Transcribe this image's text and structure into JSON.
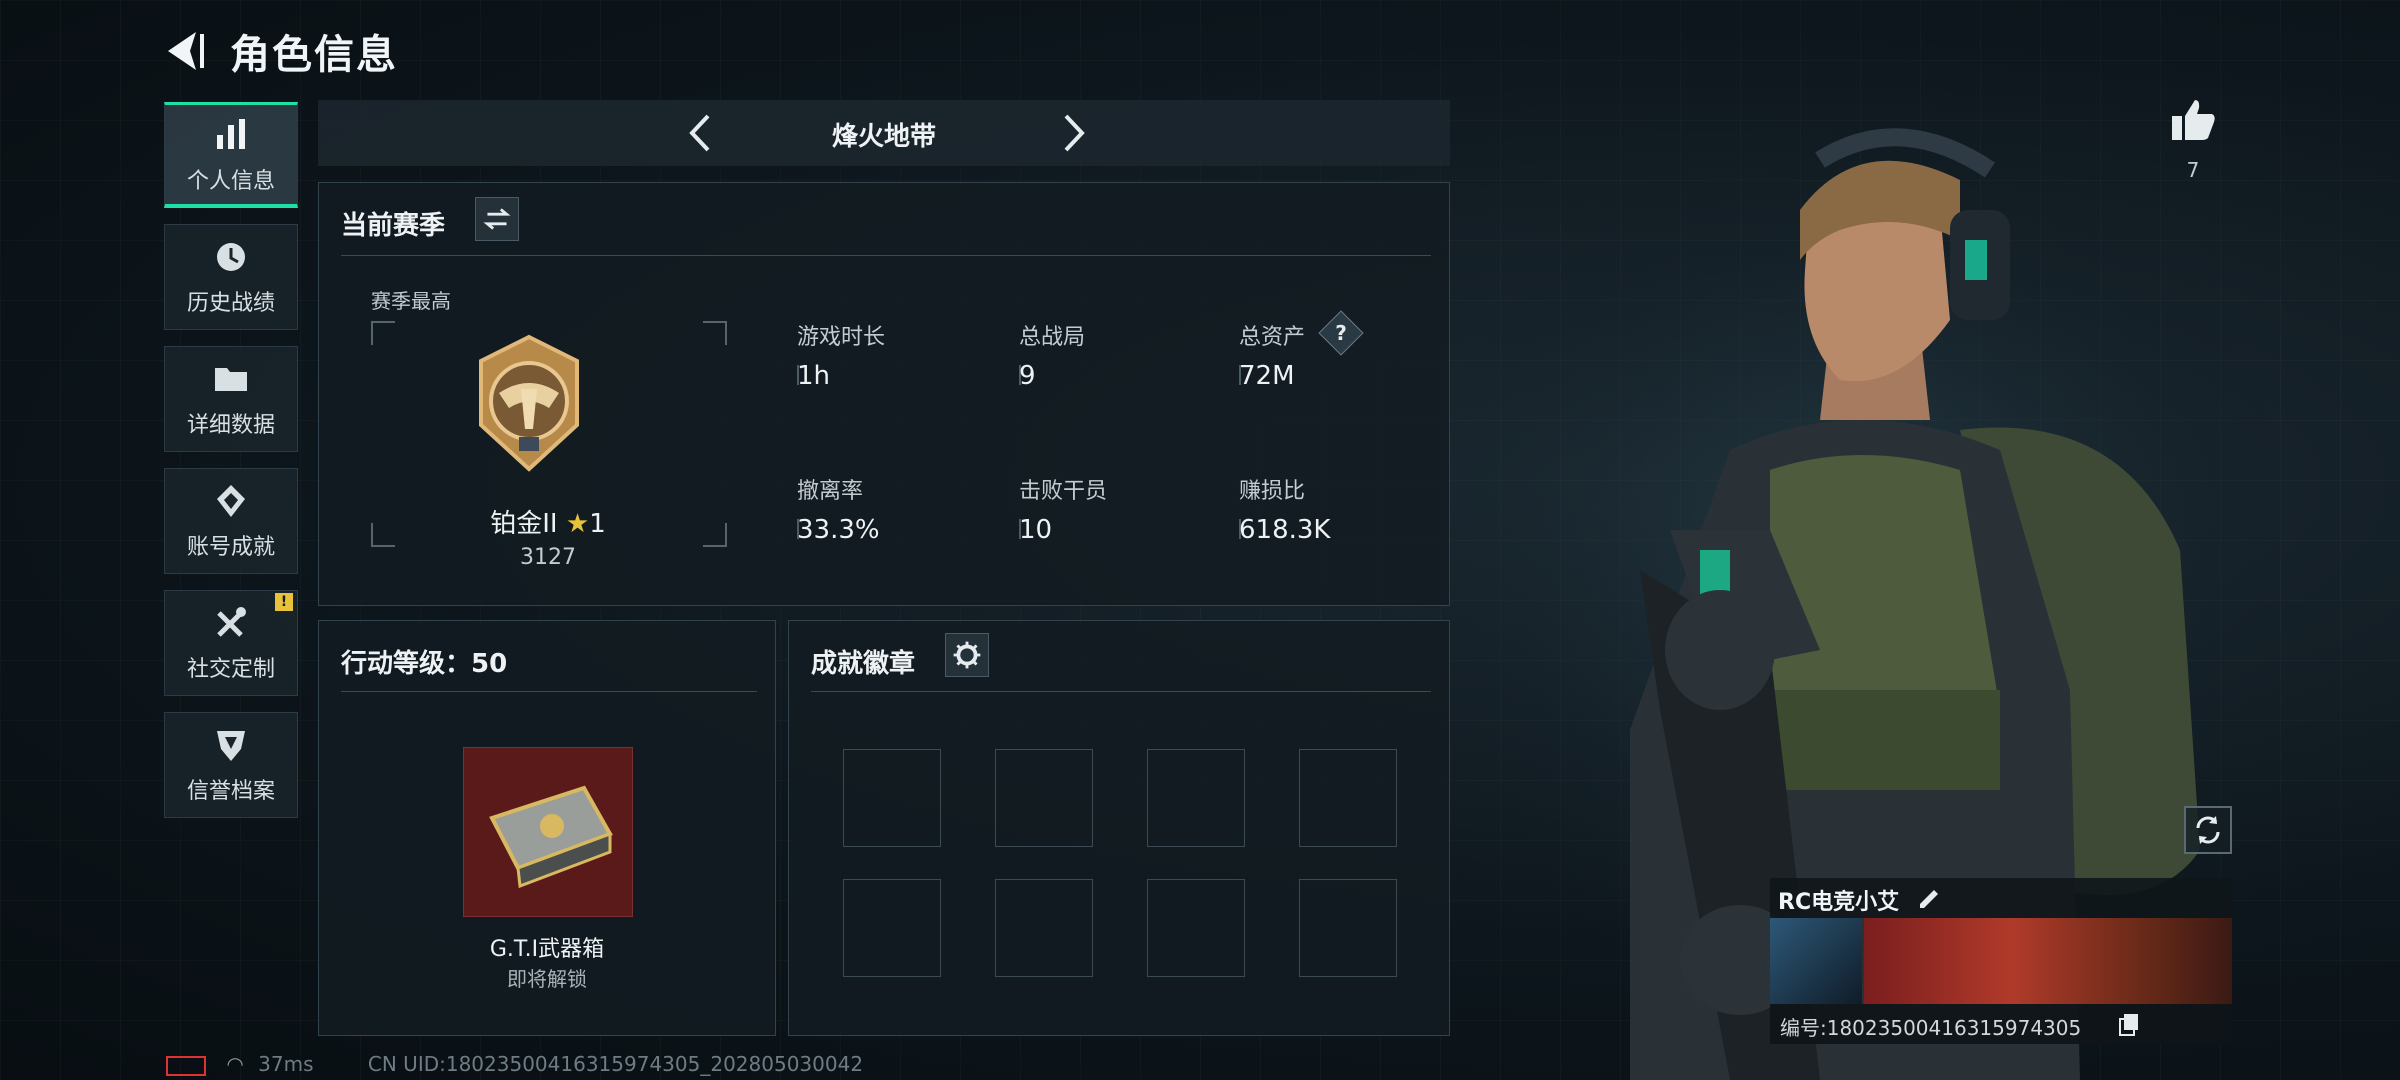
{
  "header": {
    "title": "角色信息",
    "back_icon": "back-arrow-icon"
  },
  "sidebar": {
    "items": [
      {
        "label": "个人信息",
        "icon": "bar-chart-icon",
        "active": true
      },
      {
        "label": "历史战绩",
        "icon": "clock-icon"
      },
      {
        "label": "详细数据",
        "icon": "folder-icon"
      },
      {
        "label": "账号成就",
        "icon": "achievement-icon"
      },
      {
        "label": "社交定制",
        "icon": "tools-icon",
        "badge": "!"
      },
      {
        "label": "信誉档案",
        "icon": "shield-icon"
      }
    ]
  },
  "mode": {
    "label": "烽火地带"
  },
  "season": {
    "title": "当前赛季",
    "best_label": "赛季最高",
    "rank_name": "铂金II",
    "rank_stars": "1",
    "rank_points": "3127",
    "stats": [
      {
        "label": "游戏时长",
        "value": "1h"
      },
      {
        "label": "总战局",
        "value": "9"
      },
      {
        "label": "总资产",
        "value": "72M",
        "help": "?"
      },
      {
        "label": "撤离率",
        "value": "33.3%"
      },
      {
        "label": "击败干员",
        "value": "10"
      },
      {
        "label": "赚损比",
        "value": "618.3K"
      }
    ]
  },
  "level": {
    "title": "行动等级：50",
    "reward_name": "G.T.I武器箱",
    "reward_status": "即将解锁"
  },
  "achievements": {
    "title": "成就徽章"
  },
  "likes": {
    "count": "7"
  },
  "profile": {
    "name": "RC电竞小艾",
    "id_text": "编号:18023500416315974305"
  },
  "footer": {
    "ping": "37ms",
    "uid": "CN UID:18023500416315974305_202805030042"
  },
  "colors": {
    "accent": "#1fe0a4",
    "badge": "#e8c23a",
    "reward_bg": "#5a1a1a"
  }
}
